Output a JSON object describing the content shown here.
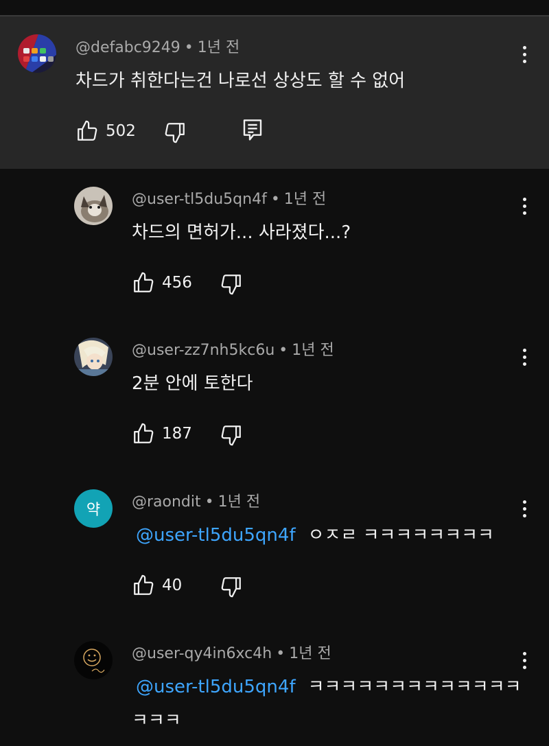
{
  "comments": [
    {
      "handle": "@defabc9249",
      "time": "1년 전",
      "text": "차드가 취한다는건 나로선 상상도 할 수 없어",
      "likes": "502"
    },
    {
      "handle": "@user-tl5du5qn4f",
      "time": "1년 전",
      "text": "차드의 면허가... 사라졌다...?",
      "likes": "456"
    },
    {
      "handle": "@user-zz7nh5kc6u",
      "time": "1년 전",
      "text": "2분 안에 토한다",
      "likes": "187"
    },
    {
      "handle": "@raondit",
      "time": "1년 전",
      "avatar_letter": "약",
      "mention": "@user-tl5du5qn4f",
      "text": "ㅇㅈㄹ ㅋㅋㅋㅋㅋㅋㅋㅋ",
      "likes": "40"
    },
    {
      "handle": "@user-qy4in6xc4h",
      "time": "1년 전",
      "mention": "@user-tl5du5qn4f",
      "text": "ㅋㅋㅋㅋㅋㅋㅋㅋㅋㅋㅋㅋㅋ",
      "text_cont": "ㅋㅋㅋ"
    }
  ],
  "separator": "•",
  "colors": {
    "background": "#0f0f0f",
    "highlight": "#272727",
    "mention": "#3ea6ff",
    "meta": "#aaaaaa",
    "avatar_letter_bg": "#12a3b5"
  },
  "icons": {
    "like": "thumbs-up-icon",
    "dislike": "thumbs-down-icon",
    "reply": "comment-reply-icon",
    "more": "more-vertical-icon"
  }
}
